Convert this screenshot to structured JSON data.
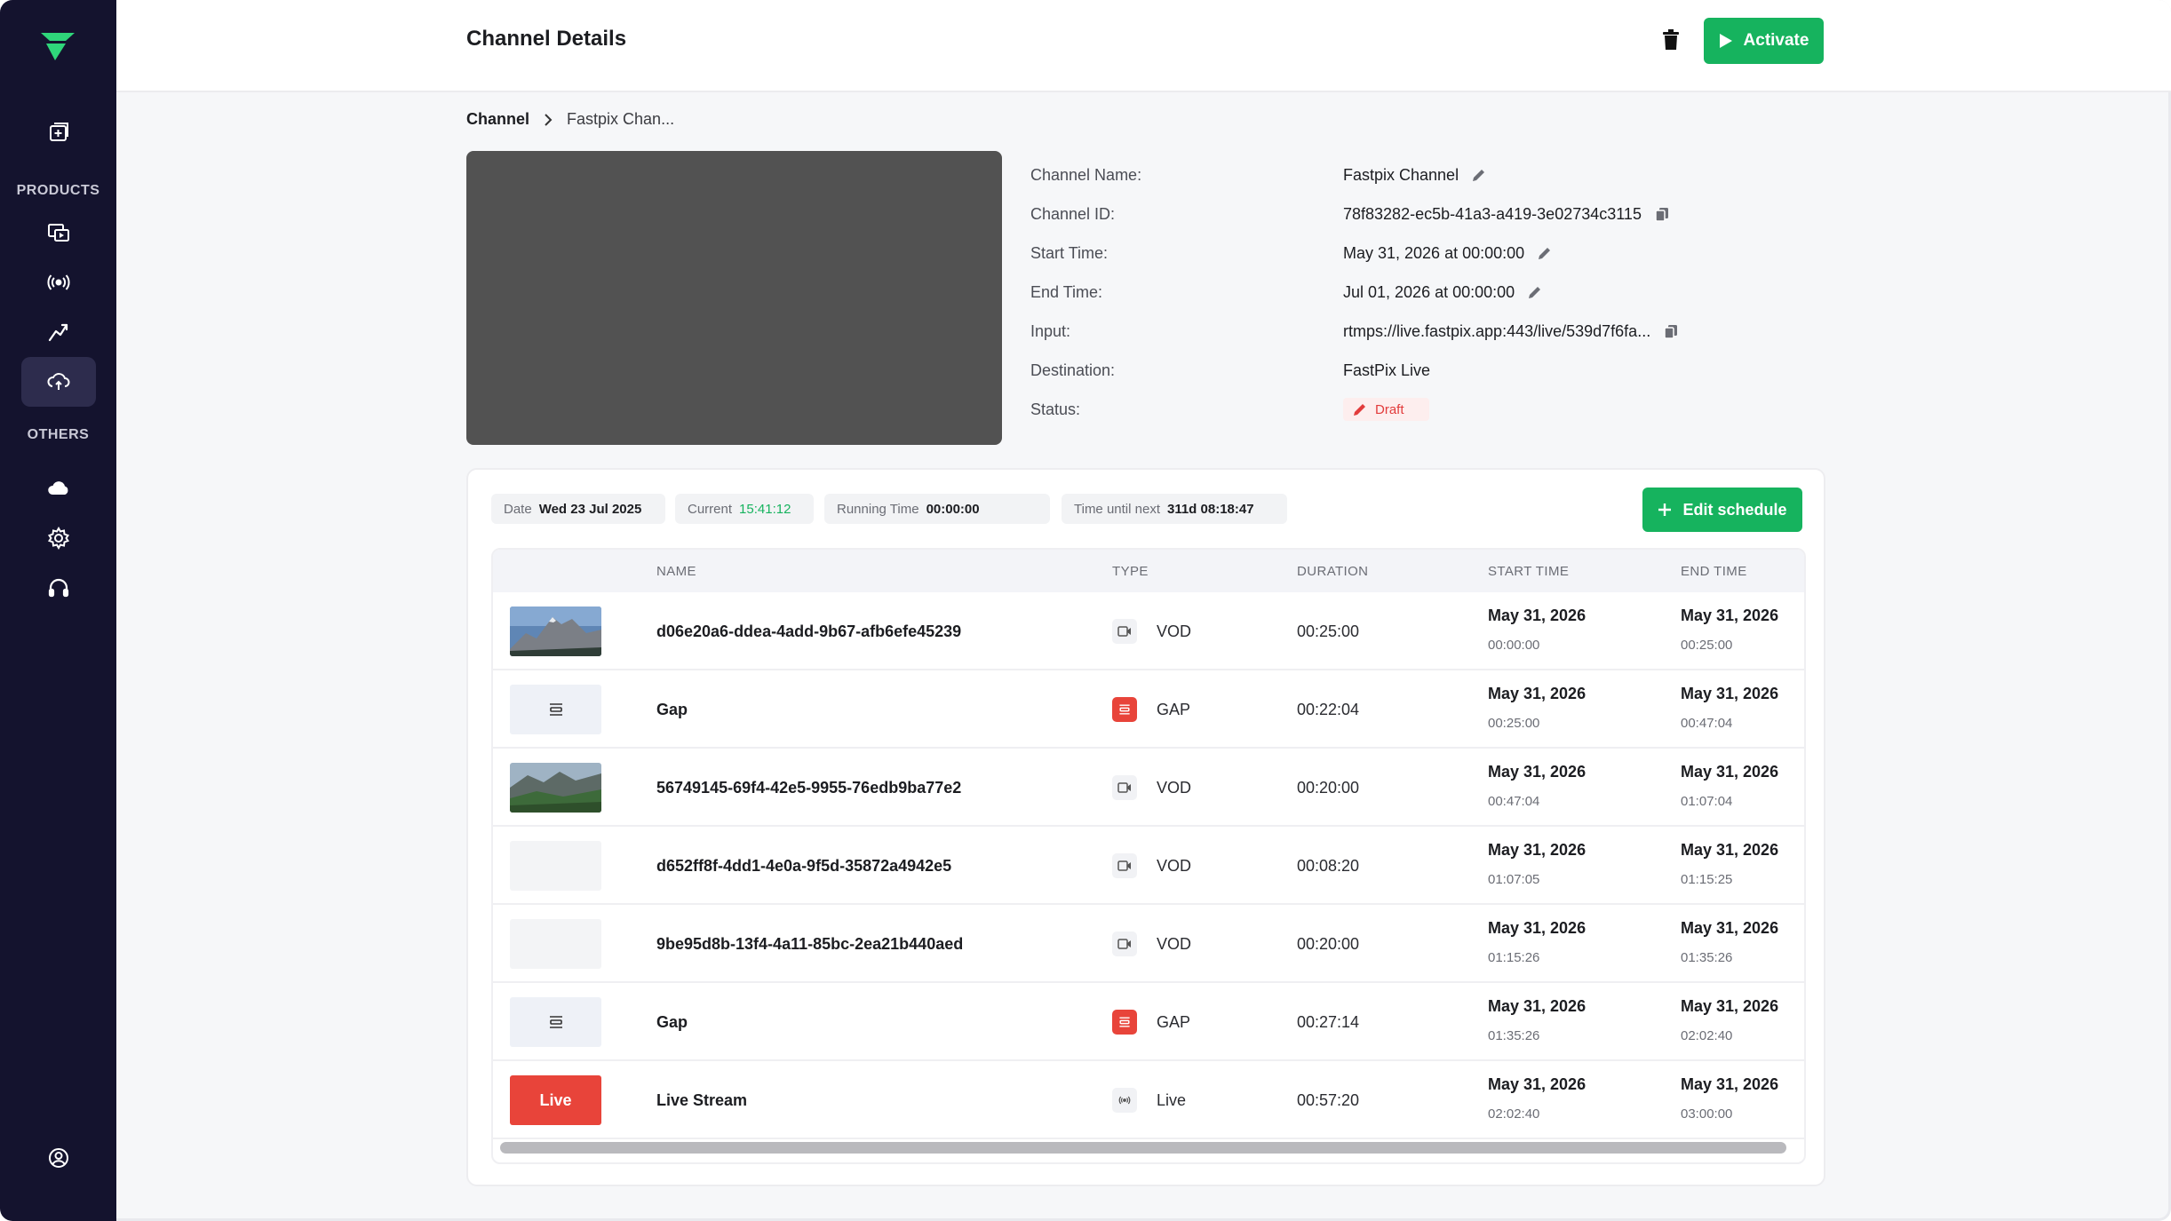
{
  "header": {
    "title": "Channel Details",
    "activate_label": "Activate"
  },
  "sidebar": {
    "products_label": "PRODUCTS",
    "others_label": "OTHERS"
  },
  "breadcrumb": {
    "root": "Channel",
    "current": "Fastpix Chan..."
  },
  "details": [
    {
      "label": "Channel Name:",
      "value": "Fastpix Channel"
    },
    {
      "label": "Channel ID:",
      "value": "78f83282-ec5b-41a3-a419-3e02734c3115"
    },
    {
      "label": "Start Time:",
      "value": "May 31, 2026 at 00:00:00"
    },
    {
      "label": "End Time:",
      "value": "Jul 01, 2026 at 00:00:00"
    },
    {
      "label": "Input:",
      "value": "rtmps://live.fastpix.app:443/live/539d7f6fa..."
    },
    {
      "label": "Destination:",
      "value": "FastPix Live"
    },
    {
      "label": "Status:",
      "value": "Draft"
    }
  ],
  "schedule": {
    "chips": [
      {
        "label": "Date",
        "value": "Wed 23 Jul 2025"
      },
      {
        "label": "Current",
        "value": "15:41:12"
      },
      {
        "label": "Running Time",
        "value": "00:00:00"
      },
      {
        "label": "Time until next",
        "value": "311d 08:18:47"
      }
    ],
    "edit_label": "Edit schedule",
    "columns": [
      "NAME",
      "TYPE",
      "DURATION",
      "START TIME",
      "END TIME"
    ],
    "rows": [
      {
        "thumb": "mountain",
        "name": "d06e20a6-ddea-4add-9b67-afb6efe45239",
        "type": "VOD",
        "duration": "00:25:00",
        "start_date": "May 31, 2026",
        "start_time": "00:00:00",
        "end_date": "May 31, 2026",
        "end_time": "00:25:00"
      },
      {
        "thumb": "gap",
        "name": "Gap",
        "type": "GAP",
        "duration": "00:22:04",
        "start_date": "May 31, 2026",
        "start_time": "00:25:00",
        "end_date": "May 31, 2026",
        "end_time": "00:47:04"
      },
      {
        "thumb": "valley",
        "name": "56749145-69f4-42e5-9955-76edb9ba77e2",
        "type": "VOD",
        "duration": "00:20:00",
        "start_date": "May 31, 2026",
        "start_time": "00:47:04",
        "end_date": "May 31, 2026",
        "end_time": "01:07:04"
      },
      {
        "thumb": "empty",
        "name": "d652ff8f-4dd1-4e0a-9f5d-35872a4942e5",
        "type": "VOD",
        "duration": "00:08:20",
        "start_date": "May 31, 2026",
        "start_time": "01:07:05",
        "end_date": "May 31, 2026",
        "end_time": "01:15:25"
      },
      {
        "thumb": "empty",
        "name": "9be95d8b-13f4-4a11-85bc-2ea21b440aed",
        "type": "VOD",
        "duration": "00:20:00",
        "start_date": "May 31, 2026",
        "start_time": "01:15:26",
        "end_date": "May 31, 2026",
        "end_time": "01:35:26"
      },
      {
        "thumb": "gap",
        "name": "Gap",
        "type": "GAP",
        "duration": "00:27:14",
        "start_date": "May 31, 2026",
        "start_time": "01:35:26",
        "end_date": "May 31, 2026",
        "end_time": "02:02:40"
      },
      {
        "thumb": "live",
        "thumb_label": "Live",
        "name": "Live Stream",
        "type": "Live",
        "duration": "00:57:20",
        "start_date": "May 31, 2026",
        "start_time": "02:02:40",
        "end_date": "May 31, 2026",
        "end_time": "03:00:00"
      }
    ]
  },
  "colors": {
    "sidebar_bg": "#14132e",
    "accent_green": "#16b35e",
    "gap_red": "#e8443a",
    "draft_red": "#e23b3b"
  }
}
